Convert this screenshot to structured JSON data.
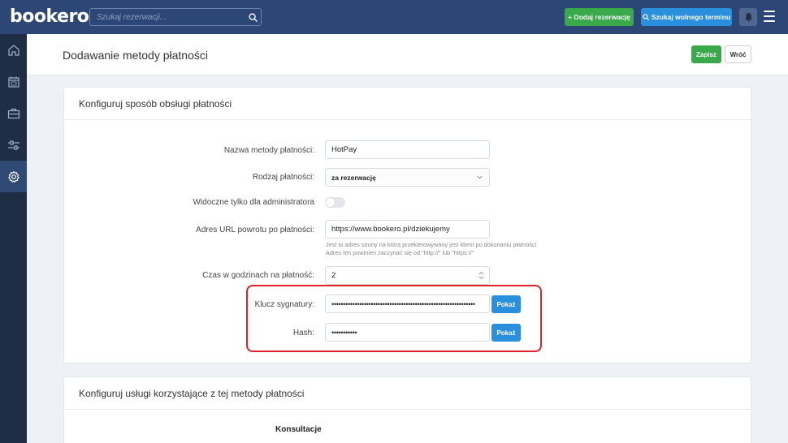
{
  "topbar": {
    "logo": "bookero",
    "search_placeholder": "Szukaj rezerwacji...",
    "add_reservation": "+ Dodaj rezerwację",
    "find_slot": "Szukaj wolnego terminu",
    "icons": [
      "search-icon",
      "bell-icon",
      "menu-icon"
    ]
  },
  "sidebar": {
    "items": [
      "home-icon",
      "calendar-icon",
      "briefcase-icon",
      "sliders-icon",
      "gear-icon"
    ],
    "active_index": 4
  },
  "page": {
    "title": "Dodawanie metody płatności",
    "save": "Zapisz",
    "back": "Wróć"
  },
  "config": {
    "title": "Konfiguruj sposób obsługi płatności",
    "name_label": "Nazwa metody płatności:",
    "name_value": "HotPay",
    "type_label": "Rodzaj płatności:",
    "type_value": "za rezerwację",
    "admin_label": "Widoczne tylko dla administratora",
    "admin_enabled": false,
    "url_label": "Adres URL powrotu po płatności:",
    "url_value": "https://www.bookero.pl/dziekujemy",
    "url_hint_1": "Jest to adres strony na którą przekierowywany jest klient po dokonaniu płatności.",
    "url_hint_2": "Adres ten powinien zaczynać się od \"http://\" lub \"https://\"",
    "hours_label": "Czas w godzinach na płatność:",
    "hours_value": "2",
    "signature_label": "Klucz sygnatury:",
    "signature_value": "••••••••••••••••••••••••••••••••••••••••••••••••••••••••••••••",
    "hash_label": "Hash:",
    "hash_value": "•••••••••••",
    "show": "Pokaż"
  },
  "services": {
    "title": "Konfiguruj usługi korzystające z tej metody płatności",
    "first": "Konsultacje"
  },
  "colors": {
    "topbar": "#2c4676",
    "sidebar": "#1f2e45",
    "green": "#3aa94a",
    "blue": "#2a8fdc",
    "highlight": "#e2222b"
  }
}
